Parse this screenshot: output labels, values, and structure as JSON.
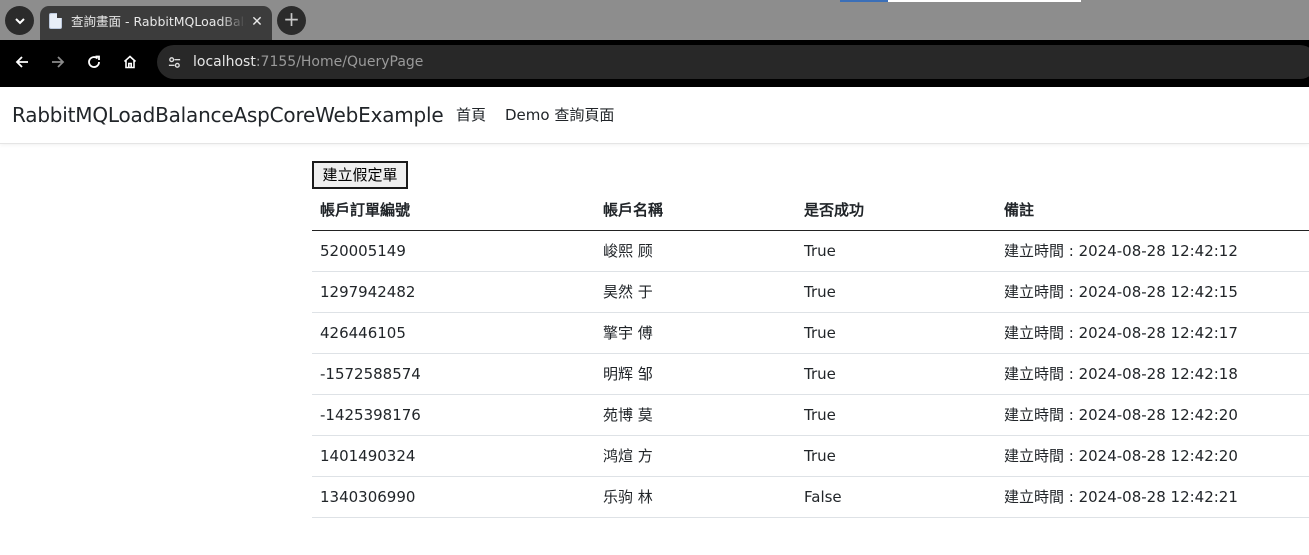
{
  "browser": {
    "tab_title": "查詢畫面 - RabbitMQLoadBalanceAspCoreWebExample",
    "tab_close_glyph": "✕",
    "new_tab_glyph": "+",
    "url_host": "localhost",
    "url_rest": ":7155/Home/QueryPage"
  },
  "navbar": {
    "brand": "RabbitMQLoadBalanceAspCoreWebExample",
    "links": [
      {
        "label": "首頁"
      },
      {
        "label": "Demo 查詢頁面"
      }
    ]
  },
  "main": {
    "create_button_label": "建立假定單",
    "columns": [
      "帳戶訂單編號",
      "帳戶名稱",
      "是否成功",
      "備註"
    ],
    "rows": [
      {
        "order_id": "520005149",
        "account_name": "峻熙 顾",
        "success": "True",
        "note": "建立時間 : 2024-08-28 12:42:12"
      },
      {
        "order_id": "1297942482",
        "account_name": "昊然 于",
        "success": "True",
        "note": "建立時間 : 2024-08-28 12:42:15"
      },
      {
        "order_id": "426446105",
        "account_name": "擎宇 傅",
        "success": "True",
        "note": "建立時間 : 2024-08-28 12:42:17"
      },
      {
        "order_id": "-1572588574",
        "account_name": "明辉 邹",
        "success": "True",
        "note": "建立時間 : 2024-08-28 12:42:18"
      },
      {
        "order_id": "-1425398176",
        "account_name": "苑博 莫",
        "success": "True",
        "note": "建立時間 : 2024-08-28 12:42:20"
      },
      {
        "order_id": "1401490324",
        "account_name": "鸿煊 方",
        "success": "True",
        "note": "建立時間 : 2024-08-28 12:42:20"
      },
      {
        "order_id": "1340306990",
        "account_name": "乐驹 林",
        "success": "False",
        "note": "建立時間 : 2024-08-28 12:42:21"
      }
    ]
  }
}
